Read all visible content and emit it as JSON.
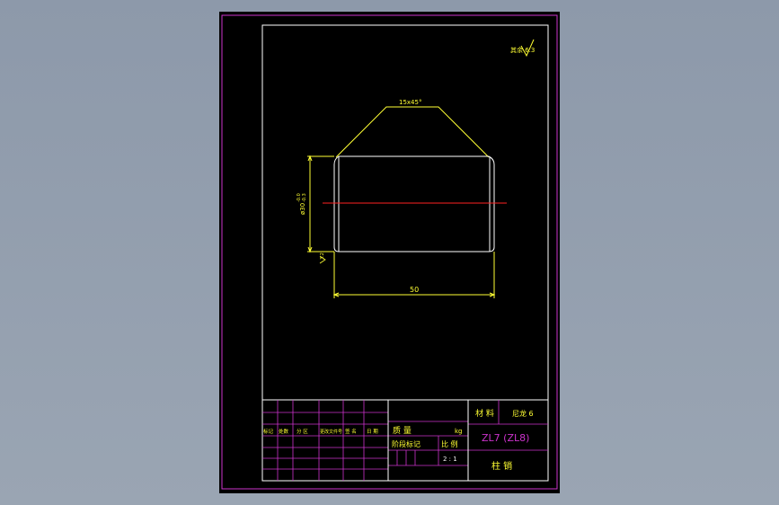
{
  "drawing": {
    "roughness_symbol": "其余 6.3",
    "chamfer_callout": "15x45°",
    "diameter_label": "ø30",
    "diameter_tolerance_upper": "-0.0",
    "diameter_tolerance_lower": "-0.3",
    "roughness_small": "3.2",
    "length_dimension": "50"
  },
  "title_block": {
    "material_label": "材 料",
    "material_value": "尼龙 6",
    "mass_label": "质 量",
    "mass_unit": "kg",
    "stage_label": "阶段标记",
    "scale_label": "比 例",
    "scale_value": "2 : 1",
    "drawing_number": "ZL7 (ZL8)",
    "part_name": "柱 销",
    "rev_headers": [
      "标记",
      "处数",
      "分 区",
      "更改文件号",
      "签 名",
      "日 期"
    ]
  },
  "colors": {
    "frame": "#cc33cc",
    "inner_border": "#ffffff",
    "outline": "#ffffff",
    "dimension": "#ffff33",
    "centerline": "#ff2222"
  }
}
